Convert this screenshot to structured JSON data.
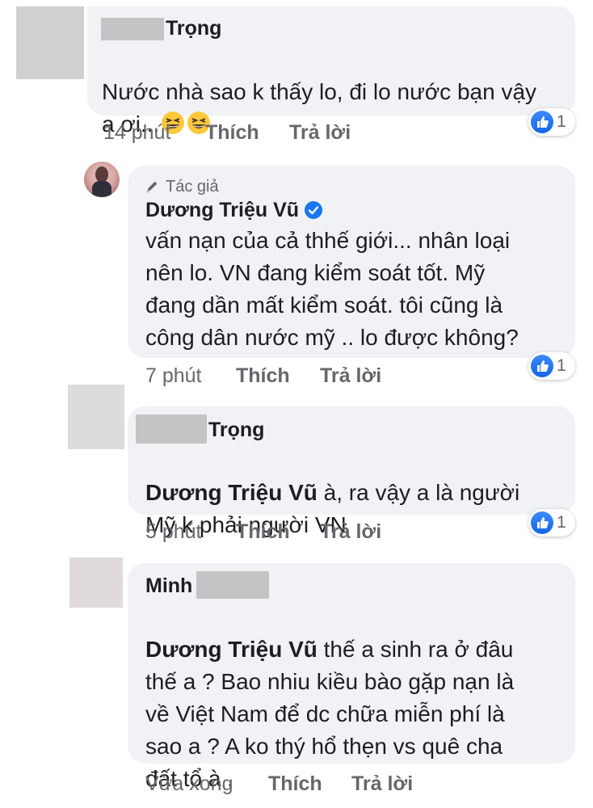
{
  "comments": [
    {
      "author": "Trọng",
      "text": "Nước nhà sao k thấy lo, đi lo nước bạn vậy a ơi...",
      "emoji": [
        "grinning-squinting-face",
        "grinning-squinting-face"
      ],
      "time": "14 phút",
      "like_label": "Thích",
      "reply_label": "Trả lời",
      "reaction_count": "1"
    },
    {
      "badge": "Tác giả",
      "author": "Dương Triệu Vũ",
      "verified": true,
      "text": "vấn nạn của cả thhế giới... nhân loại\nnên lo.  VN đang kiểm soát tốt. Mỹ\nđang dần mất kiểm soát.  tôi cũng là\ncông dân nước mỹ .. lo được không?",
      "time": "7 phút",
      "like_label": "Thích",
      "reply_label": "Trả lời",
      "reaction_count": "1"
    },
    {
      "author": "Trọng",
      "mention": "Dương Triệu Vũ",
      "text_line1": " à, ra vậy a là người",
      "text_rest": "Mỹ k phải người VN",
      "time": "5 phút",
      "like_label": "Thích",
      "reply_label": "Trả lời",
      "reaction_count": "1"
    },
    {
      "author": "Minh",
      "mention": "Dương Triệu Vũ",
      "text_line1": " thế a sinh ra ở đâu",
      "text_rest": "thế a ? Bao nhiu kiều bào gặp nạn là\nvề Việt Nam để dc chữa miễn phí là\nsao a ? A ko thý hổ thẹn vs quê cha\nđất tổ à .",
      "time": "Vừa xong",
      "like_label": "Thích",
      "reply_label": "Trả lời"
    }
  ],
  "colors": {
    "bubble": "#f0f2f5",
    "meta": "#65676b",
    "like_blue": "#1877f2"
  }
}
